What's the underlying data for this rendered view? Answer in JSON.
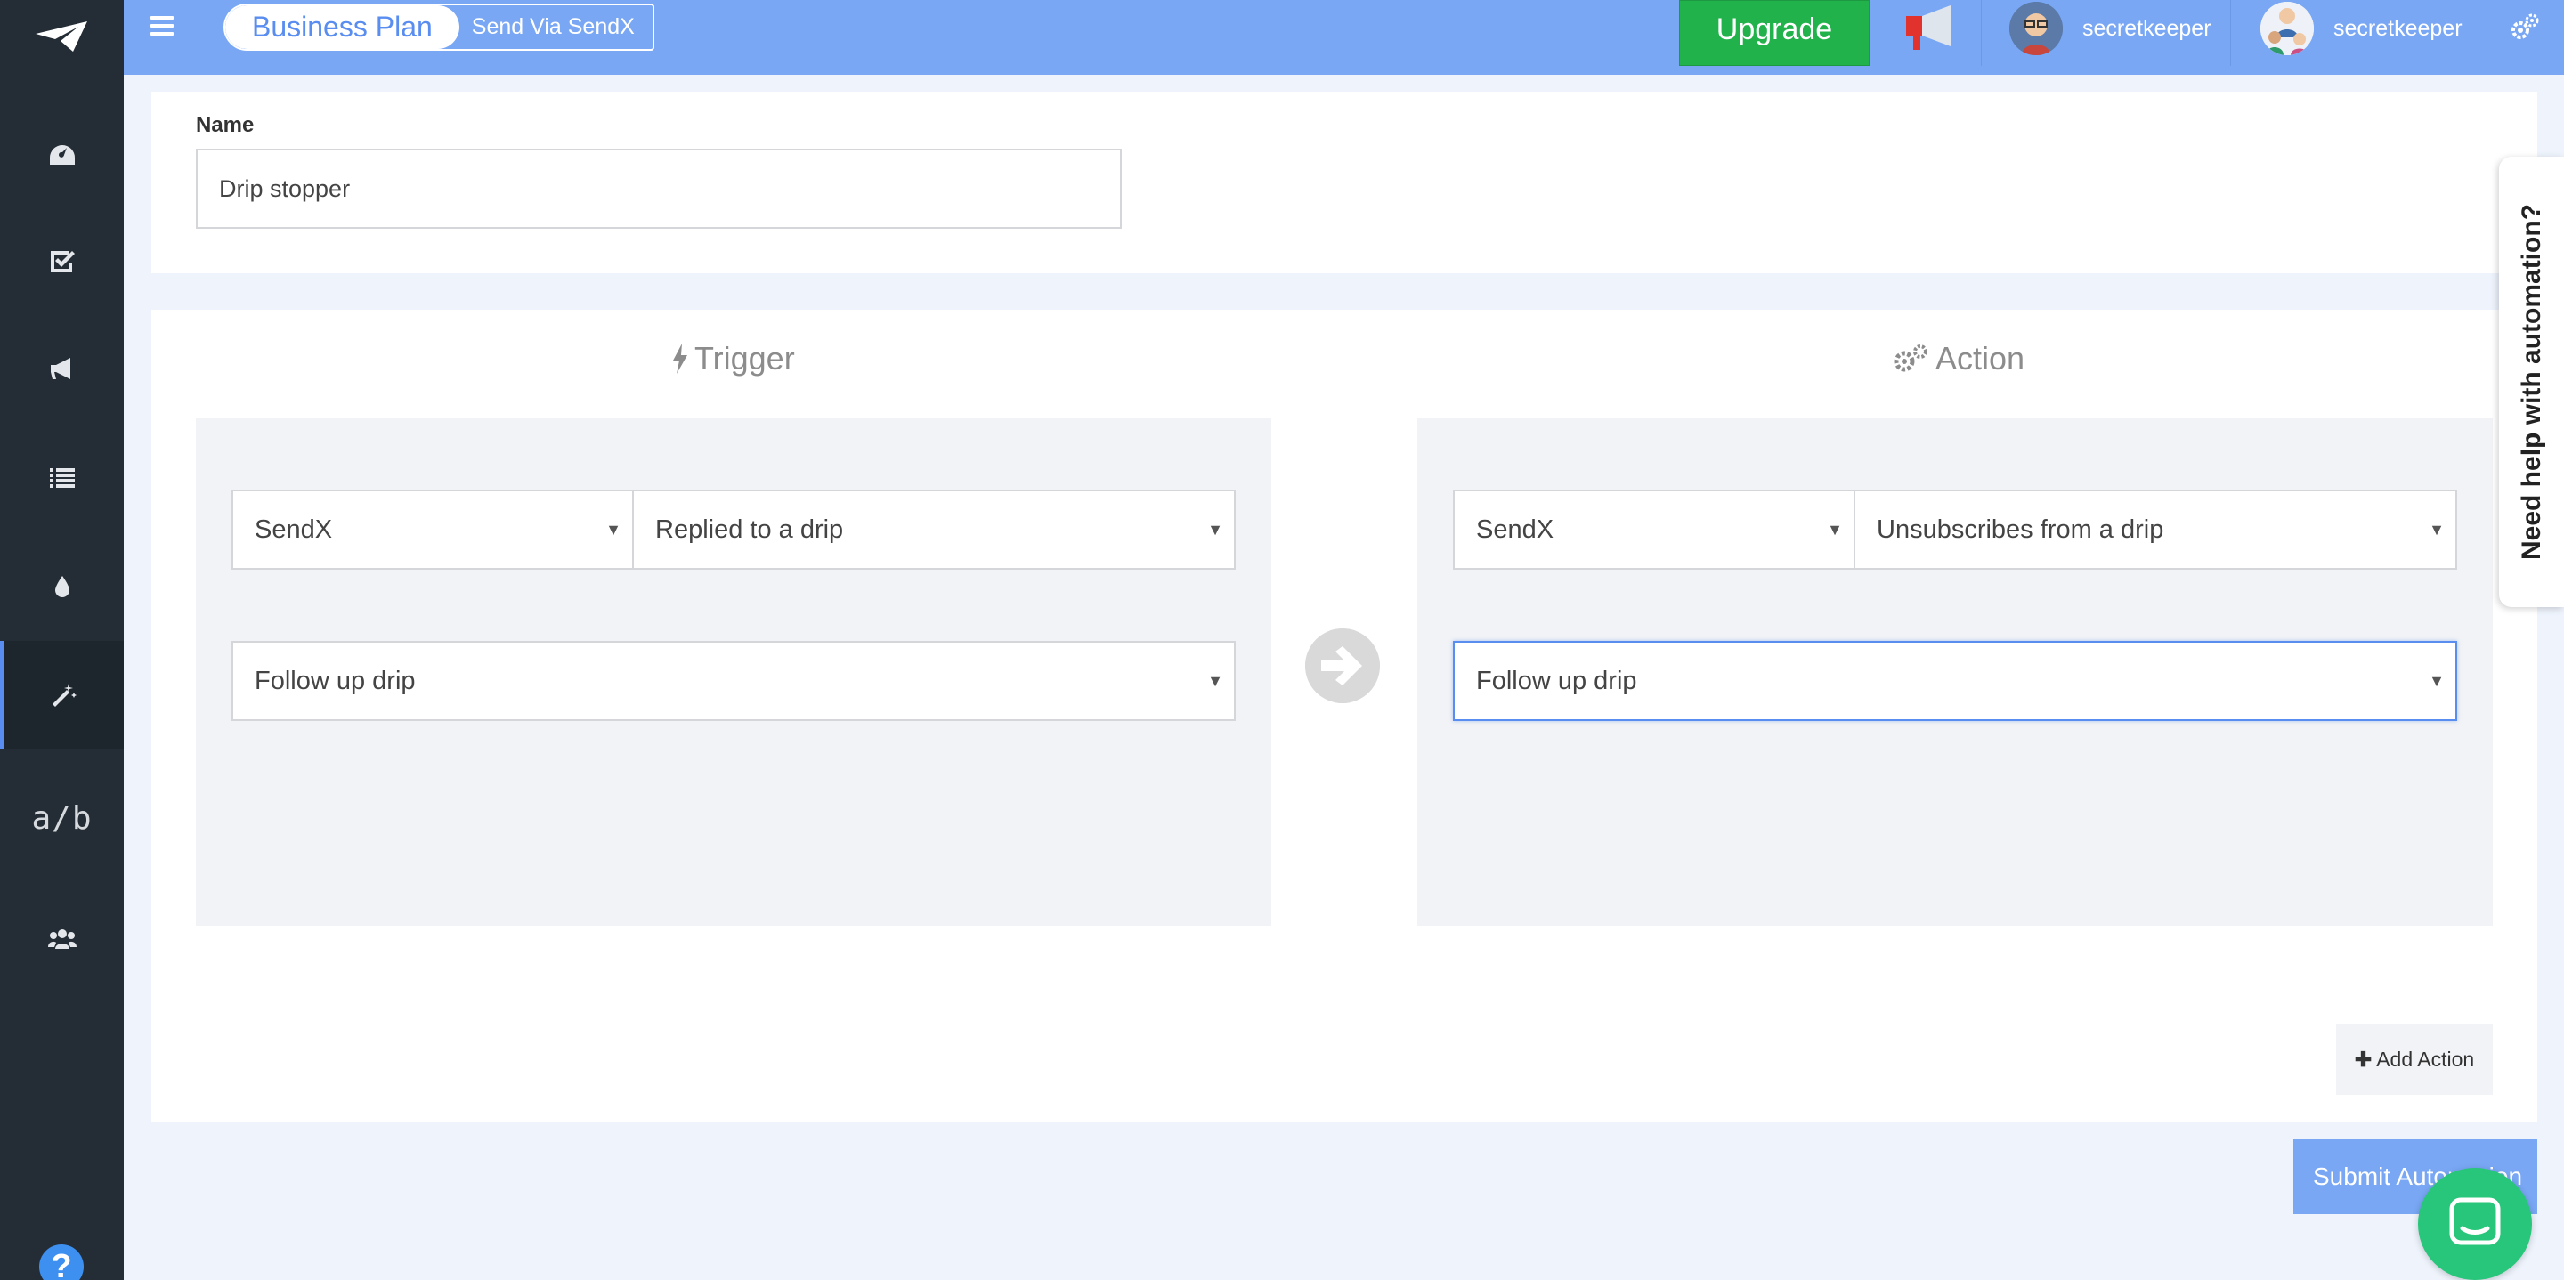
{
  "header": {
    "plan_name": "Business Plan",
    "plan_action": "Send Via SendX",
    "upgrade_label": "Upgrade",
    "users": [
      {
        "name": "secretkeeper"
      },
      {
        "name": "secretkeeper"
      }
    ]
  },
  "sidebar": {
    "items": [
      {
        "icon": "dashboard-icon"
      },
      {
        "icon": "tasks-check-icon"
      },
      {
        "icon": "campaign-megaphone-icon"
      },
      {
        "icon": "lists-icon"
      },
      {
        "icon": "drip-icon"
      },
      {
        "icon": "automation-wand-icon",
        "active": true
      },
      {
        "label": "a/b",
        "icon": "ab-test-icon"
      },
      {
        "icon": "team-icon"
      }
    ],
    "help_label": "?"
  },
  "form": {
    "name_label": "Name",
    "name_value": "Drip stopper"
  },
  "trigger": {
    "title": "Trigger",
    "source": "SendX",
    "event": "Replied to a drip",
    "drip": "Follow up drip"
  },
  "action": {
    "title": "Action",
    "source": "SendX",
    "event": "Unsubscribes from a drip",
    "drip": "Follow up drip"
  },
  "buttons": {
    "add_action": "Add Action",
    "submit": "Submit Automation"
  },
  "help_tab": "Need help with automation?",
  "colors": {
    "header": "#79a7f4",
    "sidebar": "#242d35",
    "upgrade": "#22b24c",
    "accent": "#5a8df0",
    "chat": "#27c67a"
  }
}
